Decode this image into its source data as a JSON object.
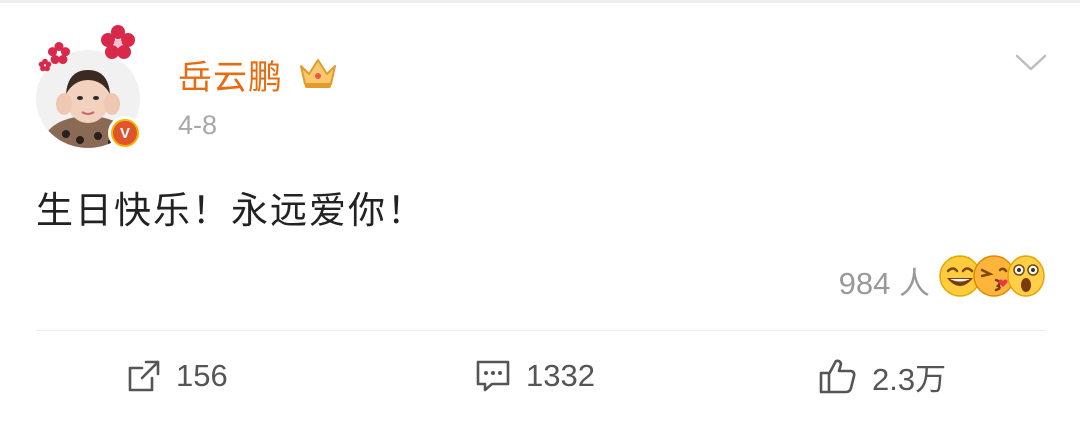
{
  "post": {
    "username": "岳云鹏",
    "date": "4-8",
    "text": "生日快乐！永远爱你！",
    "reactions_count": "984 人"
  },
  "actions": {
    "repost_count": "156",
    "comment_count": "1332",
    "like_count": "2.3万"
  },
  "colors": {
    "username": "#e86b0f",
    "meta_text": "#a8a8a8",
    "verified_badge": "#e0542c"
  },
  "icons": [
    "crown-icon",
    "chevron-down-icon",
    "verified-badge-icon",
    "repost-icon",
    "comment-icon",
    "like-icon",
    "laugh-emoji-icon",
    "kiss-emoji-icon",
    "shocked-emoji-icon"
  ]
}
